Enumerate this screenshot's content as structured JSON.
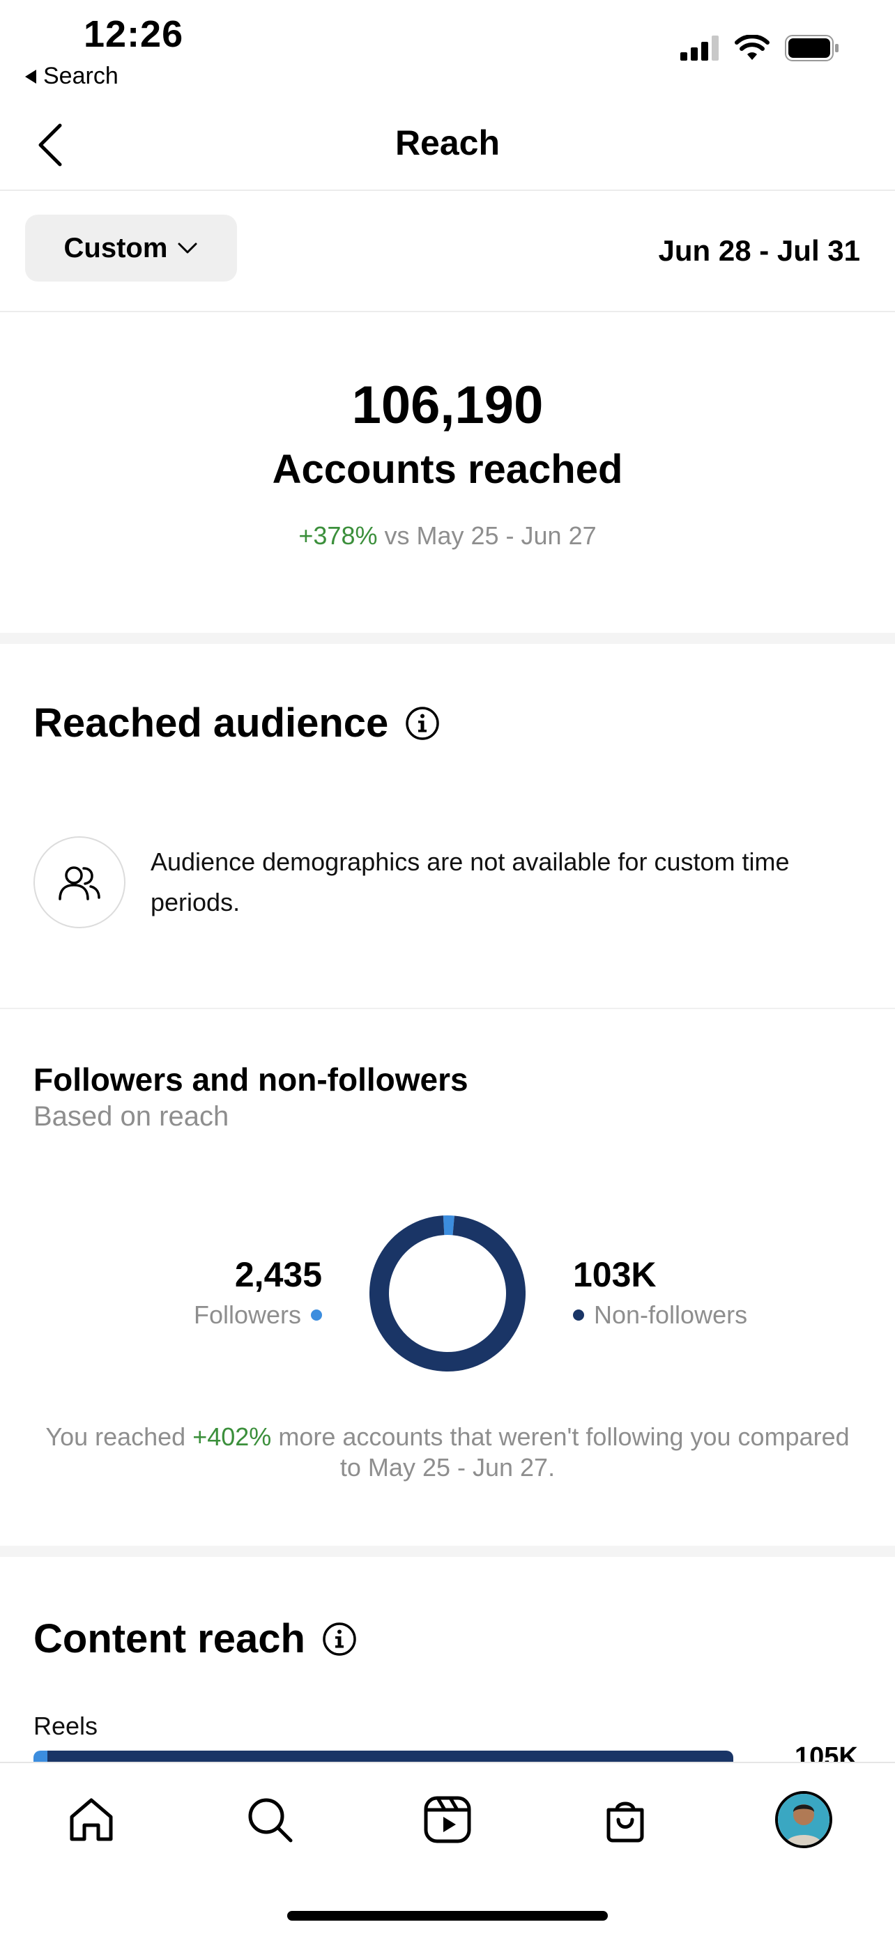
{
  "status_bar": {
    "time": "12:26",
    "back_label": "Search"
  },
  "nav": {
    "title": "Reach"
  },
  "filter": {
    "period_label": "Custom",
    "date_range": "Jun 28 - Jul 31"
  },
  "summary": {
    "value": "106,190",
    "label": "Accounts reached",
    "change": "+378%",
    "compare_text": " vs May 25 - Jun 27"
  },
  "reached_audience": {
    "title": "Reached audience",
    "message": "Audience demographics are not available for custom time periods."
  },
  "followers": {
    "title": "Followers and non-followers",
    "subtitle": "Based on reach",
    "followers_value": "2,435",
    "followers_label": "Followers",
    "non_followers_value": "103K",
    "non_followers_label": "Non-followers",
    "note_prefix": "You reached ",
    "note_change": "+402%",
    "note_suffix": " more accounts that weren't following you compared to May 25 - Jun 27.",
    "colors": {
      "followers": "#3c8dde",
      "non_followers": "#1a3566"
    }
  },
  "chart_data": {
    "type": "pie",
    "categories": [
      "Followers",
      "Non-followers"
    ],
    "values": [
      2435,
      103755
    ]
  },
  "content_reach": {
    "title": "Content reach",
    "reels_label": "Reels",
    "reels_value": "105K",
    "reels_followers_fraction": 0.02,
    "reels_fraction": 1.0
  },
  "tab_bar": {
    "items": [
      "home-icon",
      "search-icon",
      "reels-icon",
      "shop-icon",
      "profile-avatar"
    ]
  }
}
